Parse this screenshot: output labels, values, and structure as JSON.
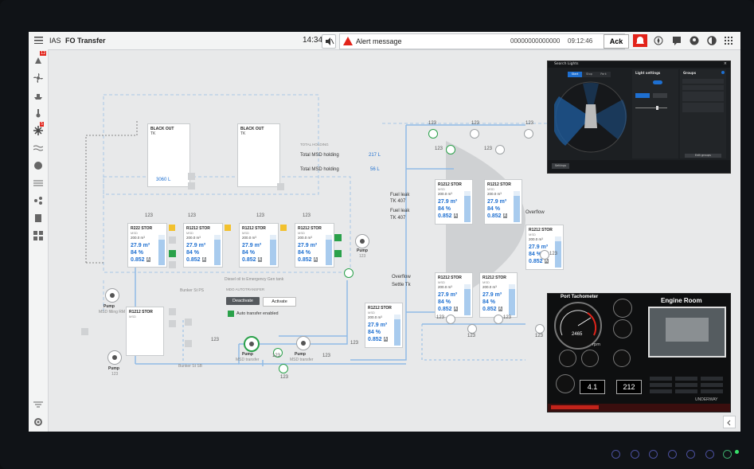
{
  "topbar": {
    "app": "IAS",
    "title": "FO Transfer",
    "time": "14:34",
    "alert": "Alert message",
    "alert_code": "00000000000000",
    "alert_time": "09:12:46",
    "ack": "Ack"
  },
  "sidebar": {
    "badge_top": "12",
    "badge_mid": "5"
  },
  "holding": {
    "title": "TOTAL HOLDING",
    "rows": [
      {
        "label": "Total MSD holding",
        "value": "217 L"
      },
      {
        "label": "Total MSD holding",
        "value": "56 L"
      }
    ]
  },
  "blackout": [
    {
      "title": "BLACK OUT",
      "sub": "TK",
      "value": "3060 L"
    },
    {
      "title": "BLACK OUT",
      "sub": "TK"
    }
  ],
  "tanks": [
    {
      "name": "R222 STOR",
      "sub": "MSD",
      "vol": "200.0 m³",
      "v1": "27.9 m³",
      "v2": "84 %",
      "v3": "0.852"
    },
    {
      "name": "R1212 STOR",
      "sub": "MSD",
      "vol": "200.0 m³",
      "v1": "27.9 m³",
      "v2": "84 %",
      "v3": "0.852"
    },
    {
      "name": "R1212 STOR",
      "sub": "MSD",
      "vol": "200.0 m³",
      "v1": "27.9 m³",
      "v2": "84 %",
      "v3": "0.852"
    },
    {
      "name": "R1212 STOR",
      "sub": "MSD",
      "vol": "200.0 m³",
      "v1": "27.9 m³",
      "v2": "84 %",
      "v3": "0.852"
    },
    {
      "name": "R1212 STOR",
      "sub": "MSD",
      "vol": "200.0 m³",
      "v1": "27.9 m³",
      "v2": "84 %",
      "v3": "0.852"
    },
    {
      "name": "R1212 STOR",
      "sub": "MSD",
      "vol": "200.0 m³",
      "v1": "27.9 m³",
      "v2": "84 %",
      "v3": "0.852"
    },
    {
      "name": "R1212 STOR",
      "sub": "MSD",
      "vol": "200.0 m³",
      "v1": "27.9 m³",
      "v2": "84 %",
      "v3": "0.852"
    },
    {
      "name": "R1212 STOR",
      "sub": "MSD",
      "vol": "200.0 m³",
      "v1": "27.9 m³",
      "v2": "84 %",
      "v3": "0.852"
    },
    {
      "name": "R1212 STOR",
      "sub": "MSD",
      "vol": "200.0 m³",
      "v1": "27.9 m³",
      "v2": "84 %",
      "v3": "0.852"
    },
    {
      "name": "R1212 STOR",
      "sub": "MSD",
      "vol": "200.0 m³",
      "v1": "27.9 m³",
      "v2": "84 %",
      "v3": "0.852"
    },
    {
      "name": "R1212 STOR",
      "sub": "MSD",
      "vol": "200.0 m³",
      "v1": "27.9 m³",
      "v2": "84 %",
      "v3": "0.852"
    }
  ],
  "small_tank": {
    "name": "R1212 STOR",
    "sub": "MSD"
  },
  "labels": {
    "n123": "123",
    "fuel_leak1": "Fuel leak",
    "tk407a": "TK 407",
    "fuel_leak2": "Fuel leak",
    "tk407b": "TK 407",
    "overflow_settle": "Overflow",
    "settle_tk": "Settle Tk",
    "overflow": "Overflow",
    "pump": "Pump",
    "pump_sub": "123",
    "pump_msd_filling": "MSD filling RM",
    "pump_msd_transfer": "MSD transfer",
    "pump_msd_transfer2": "MSD transfer",
    "bunker_ps": "Bunker St PS",
    "bunker_sb": "Bunker St SB",
    "diesel_oil": "Diesel oil to Emergency Gen tank"
  },
  "autotransfer": {
    "title": "MDO AUTOTRANSFER",
    "deactivate": "Deactivate",
    "activate": "Activate",
    "enabled": "Auto transfer enabled"
  },
  "search_lights": {
    "title": "Search Lights",
    "tabs": [
      "Start",
      "Stop",
      "Park"
    ],
    "settings_title": "Light settings",
    "groups_title": "Groups",
    "btn": "Settings",
    "btn2": "Edit groups"
  },
  "engine": {
    "tach_title": "Port Tachometer",
    "room_title": "Engine Room",
    "rpm_value": "2465",
    "rpm_unit": "rpm",
    "digital1": "4.1",
    "digital2": "212",
    "status": "UNDERWAY"
  },
  "colors": {
    "accent": "#1e6fd0",
    "green": "#2aa14a",
    "alert_red": "#e2231a",
    "pipe_blue": "#9cc4ea"
  }
}
